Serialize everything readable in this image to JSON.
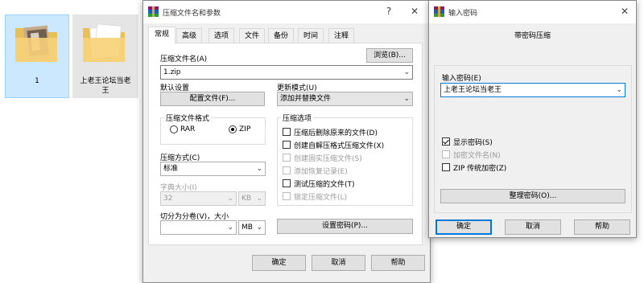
{
  "explorer": {
    "files": [
      {
        "name": "1"
      },
      {
        "name": "上老王论坛当老王"
      }
    ]
  },
  "archive_dialog": {
    "title": "压缩文件名和参数",
    "help_glyph": "?",
    "close_glyph": "✕",
    "tabs": [
      "常规",
      "高级",
      "选项",
      "文件",
      "备份",
      "时间",
      "注释"
    ],
    "archive_name_label": "压缩文件名(A)",
    "browse_button": "浏览(B)...",
    "archive_name_value": "1.zip",
    "default_settings_label": "默认设置",
    "profiles_button": "配置文件(F)...",
    "update_mode_label": "更新模式(U)",
    "update_mode_value": "添加并替换文件",
    "format_group_label": "压缩文件格式",
    "format_rar": "RAR",
    "format_zip": "ZIP",
    "options_group_label": "压缩选项",
    "options": [
      {
        "label": "压缩后删除原来的文件(D)",
        "checked": false,
        "enabled": true
      },
      {
        "label": "创建自解压格式压缩文件(X)",
        "checked": false,
        "enabled": true
      },
      {
        "label": "创建固实压缩文件(S)",
        "checked": false,
        "enabled": false
      },
      {
        "label": "添加恢复记录(E)",
        "checked": false,
        "enabled": false
      },
      {
        "label": "测试压缩的文件(T)",
        "checked": false,
        "enabled": true
      },
      {
        "label": "锁定压缩文件(L)",
        "checked": false,
        "enabled": false
      }
    ],
    "method_label": "压缩方式(C)",
    "method_value": "标准",
    "dict_label": "字典大小(I)",
    "dict_value": "32",
    "dict_unit": "KB",
    "split_label": "切分为分卷(V)，大小",
    "split_value": "",
    "split_unit": "MB",
    "set_password_button": "设置密码(P)...",
    "ok_button": "确定",
    "cancel_button": "取消",
    "help_button": "帮助"
  },
  "password_dialog": {
    "title": "输入密码",
    "close_glyph": "✕",
    "heading": "带密码压缩",
    "password_label": "输入密码(E)",
    "password_value": "上老王论坛当老王",
    "show_password": "显示密码(S)",
    "encrypt_names": "加密文件名(N)",
    "zip_legacy": "ZIP 传统加密(Z)",
    "organize_button": "整理密码(O)...",
    "ok_button": "确定",
    "cancel_button": "取消",
    "help_button": "帮助"
  },
  "colors": {
    "selection": "#cce8ff",
    "accent": "#0078d7"
  }
}
